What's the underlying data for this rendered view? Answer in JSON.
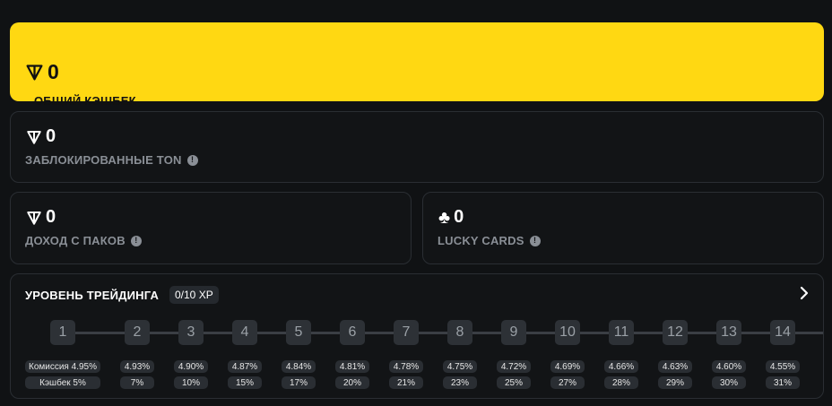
{
  "colors": {
    "accent": "#ffd812",
    "background": "#101214",
    "card_border": "#2a2e33",
    "muted": "#8a8f96"
  },
  "total_cashback": {
    "value": "0",
    "label": "ОБЩИЙ КЭШБЕК",
    "icon": "ton-icon"
  },
  "locked_ton": {
    "value": "0",
    "label": "ЗАБЛОКИРОВАННЫЕ TON",
    "icon": "ton-icon",
    "info_icon": "info-icon"
  },
  "pack_income": {
    "value": "0",
    "label": "ДОХОД С ПАКОВ",
    "icon": "ton-icon",
    "info_icon": "info-icon"
  },
  "lucky_cards": {
    "value": "0",
    "label": "LUCKY CARDS",
    "icon": "club-icon",
    "info_icon": "info-icon"
  },
  "trading_level": {
    "title": "УРОВЕНЬ ТРЕЙДИНГА",
    "xp": "0/10 XP",
    "levels": [
      {
        "num": "1",
        "commission": "Комиссия 4.95%",
        "cashback": "Кэшбек 5%"
      },
      {
        "num": "2",
        "commission": "4.93%",
        "cashback": "7%"
      },
      {
        "num": "3",
        "commission": "4.90%",
        "cashback": "10%"
      },
      {
        "num": "4",
        "commission": "4.87%",
        "cashback": "15%"
      },
      {
        "num": "5",
        "commission": "4.84%",
        "cashback": "17%"
      },
      {
        "num": "6",
        "commission": "4.81%",
        "cashback": "20%"
      },
      {
        "num": "7",
        "commission": "4.78%",
        "cashback": "21%"
      },
      {
        "num": "8",
        "commission": "4.75%",
        "cashback": "23%"
      },
      {
        "num": "9",
        "commission": "4.72%",
        "cashback": "25%"
      },
      {
        "num": "10",
        "commission": "4.69%",
        "cashback": "27%"
      },
      {
        "num": "11",
        "commission": "4.66%",
        "cashback": "28%"
      },
      {
        "num": "12",
        "commission": "4.63%",
        "cashback": "29%"
      },
      {
        "num": "13",
        "commission": "4.60%",
        "cashback": "30%"
      },
      {
        "num": "14",
        "commission": "4.55%",
        "cashback": "31%"
      }
    ]
  }
}
